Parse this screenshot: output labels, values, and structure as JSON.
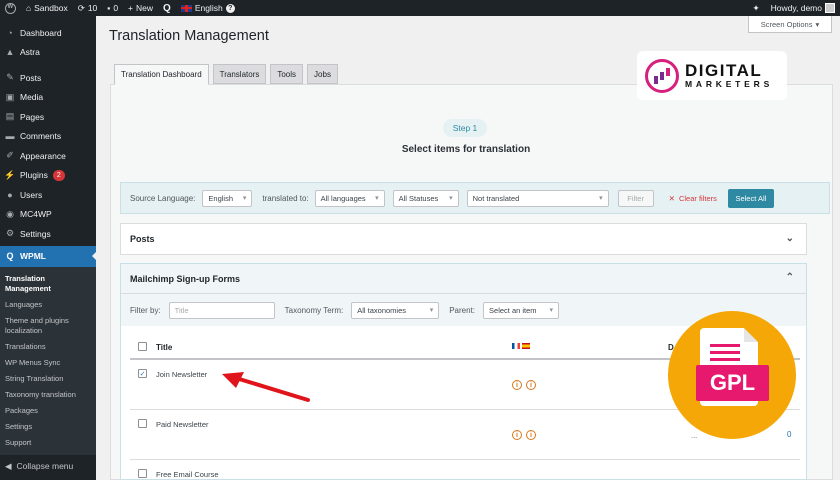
{
  "admin_bar": {
    "site_name": "Sandbox",
    "updates_count": "10",
    "comments_count": "0",
    "new_label": "New",
    "language_label": "English",
    "howdy": "Howdy, demo"
  },
  "screen_options": "Screen Options",
  "sidebar": {
    "items": [
      {
        "label": "Dashboard",
        "icon": "dashboard-icon"
      },
      {
        "label": "Astra",
        "icon": "astra-icon"
      },
      {
        "label": "Posts",
        "icon": "pin-icon"
      },
      {
        "label": "Media",
        "icon": "media-icon"
      },
      {
        "label": "Pages",
        "icon": "pages-icon"
      },
      {
        "label": "Comments",
        "icon": "comment-icon"
      },
      {
        "label": "Appearance",
        "icon": "brush-icon"
      },
      {
        "label": "Plugins",
        "icon": "plugin-icon",
        "badge": "2"
      },
      {
        "label": "Users",
        "icon": "users-icon"
      },
      {
        "label": "MC4WP",
        "icon": "mc4wp-icon"
      },
      {
        "label": "Settings",
        "icon": "settings-icon"
      }
    ],
    "active": "WPML",
    "submenu": [
      "Translation Management",
      "Languages",
      "Theme and plugins localization",
      "Translations",
      "WP Menus Sync",
      "String Translation",
      "Taxonomy translation",
      "Packages",
      "Settings",
      "Support"
    ],
    "collapse": "Collapse menu"
  },
  "page": {
    "title": "Translation Management",
    "tabs": [
      "Translation Dashboard",
      "Translators",
      "Tools",
      "Jobs"
    ],
    "step": "Step 1",
    "step_subtitle": "Select items for translation"
  },
  "filters": {
    "source_language_label": "Source Language:",
    "source_language": "English",
    "translated_to_label": "translated to:",
    "translated_to": "All languages",
    "status": "All Statuses",
    "translation_state": "Not translated",
    "filter_button": "Filter",
    "clear_filters": "Clear filters",
    "select_all": "Select All"
  },
  "posts_section": {
    "title": "Posts"
  },
  "mailchimp_section": {
    "title": "Mailchimp Sign-up Forms",
    "filter_by_label": "Filter by:",
    "title_placeholder": "Title",
    "taxonomy_label": "Taxonomy Term:",
    "taxonomy_value": "All taxonomies",
    "parent_label": "Parent:",
    "parent_value": "Select an item",
    "columns": {
      "title": "Title",
      "date": "D"
    },
    "rows": [
      {
        "title": "Join Newsletter",
        "checked": true,
        "dots": "",
        "count": ""
      },
      {
        "title": "Paid Newsletter",
        "checked": false,
        "dots": "...",
        "count": "0"
      },
      {
        "title": "Free Email Course",
        "checked": false,
        "dots": "",
        "count": ""
      }
    ]
  },
  "overlay": {
    "logo_line1": "DIGITAL",
    "logo_line2": "MARKETERS",
    "gpl_label": "GPL",
    "arrow_color": "#e0151b"
  },
  "colors": {
    "admin_bg": "#1d2327",
    "wp_blue": "#2271b1",
    "accent_teal": "#2e8aa3",
    "warning_orange": "#d8771b",
    "gpl_orange": "#f6a708",
    "gpl_pink": "#e6196f"
  }
}
